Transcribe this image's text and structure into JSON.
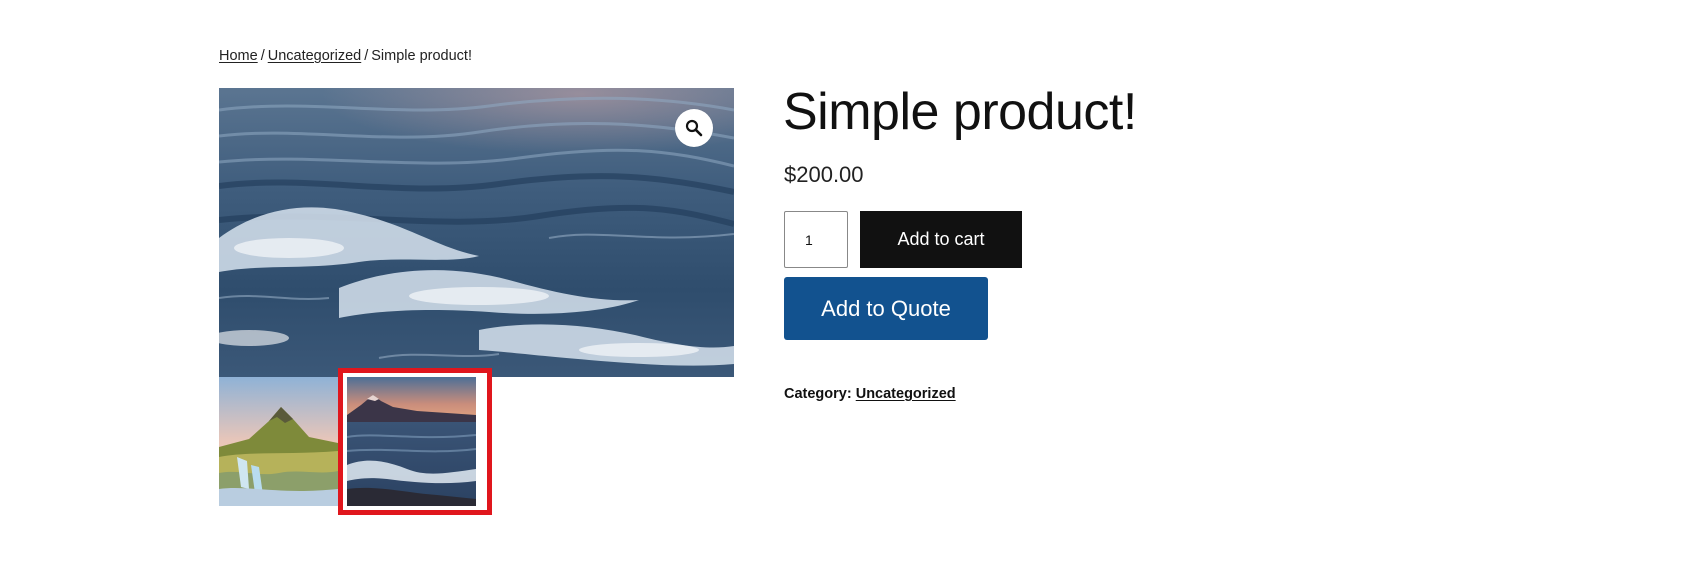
{
  "breadcrumb": {
    "home": "Home",
    "separator": "/",
    "category": "Uncategorized",
    "current": "Simple product!"
  },
  "gallery": {
    "zoom_icon": "magnifier-icon",
    "thumbnails": [
      {
        "name": "mountain-landscape-thumbnail",
        "selected": false
      },
      {
        "name": "ocean-sunset-thumbnail",
        "selected": true
      }
    ],
    "highlight_color": "#e0161d"
  },
  "product": {
    "title": "Simple product!",
    "price": "$200.00",
    "quantity": "1",
    "add_to_cart_label": "Add to cart",
    "add_to_quote_label": "Add to Quote",
    "category_label": "Category:",
    "category_value": "Uncategorized"
  },
  "colors": {
    "cart_button": "#111111",
    "quote_button": "#12528f"
  }
}
